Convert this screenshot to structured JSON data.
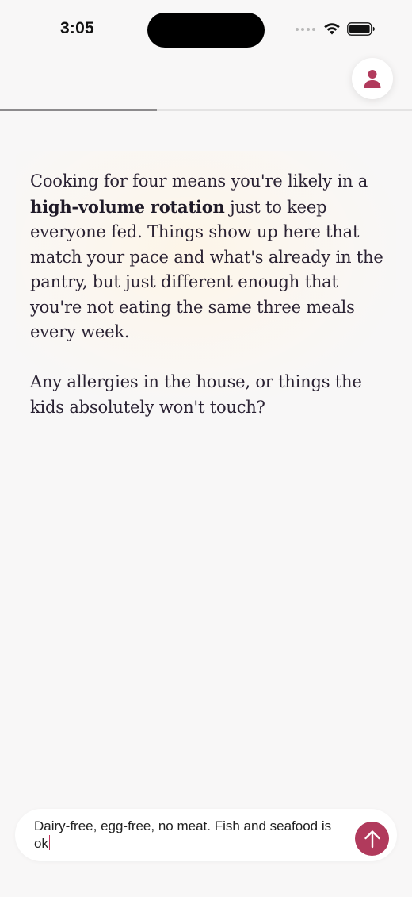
{
  "status_bar": {
    "time": "3:05",
    "icons": [
      "signal-dots-icon",
      "wifi-icon",
      "battery-icon"
    ]
  },
  "header": {
    "profile_icon": "person-icon",
    "progress": 0.38
  },
  "message": {
    "paragraph_1": {
      "before": "Cooking for four means you're likely in a ",
      "bold": "high-volume rotation",
      "after": " just to keep everyone fed. Things show up here that match your pace and what's already in the pantry, but just different enough that you're not eating the same three meals every week."
    },
    "paragraph_2": "Any allergies in the house, or things the kids absolutely won't touch?"
  },
  "composer": {
    "value": "Dairy-free, egg-free, no meat. Fish and seafood is ok",
    "send_icon": "arrow-up-icon"
  },
  "colors": {
    "accent": "#b13a5c",
    "background": "#f8f7f7",
    "text": "#2a2233"
  }
}
